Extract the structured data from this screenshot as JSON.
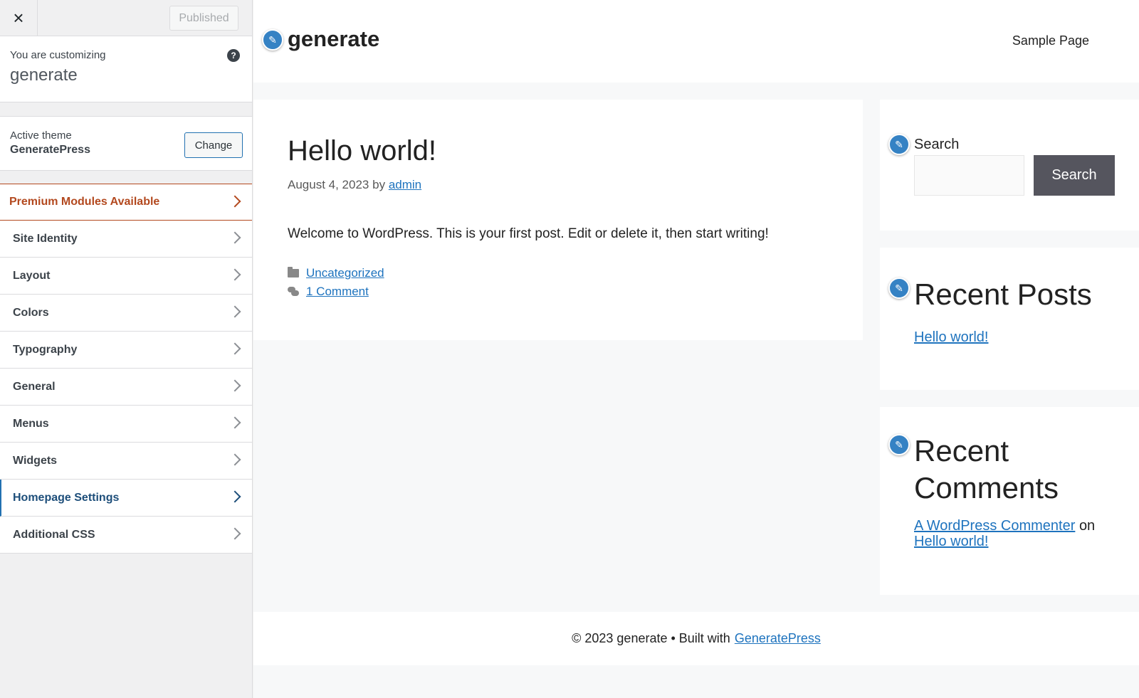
{
  "sidebar": {
    "close_icon": "×",
    "published_label": "Published",
    "customizing_label": "You are customizing",
    "site_name": "generate",
    "help_icon": "?",
    "active_theme_label": "Active theme",
    "active_theme_name": "GeneratePress",
    "change_label": "Change",
    "panels": [
      {
        "label": "Premium Modules Available"
      },
      {
        "label": "Site Identity"
      },
      {
        "label": "Layout"
      },
      {
        "label": "Colors"
      },
      {
        "label": "Typography"
      },
      {
        "label": "General"
      },
      {
        "label": "Menus"
      },
      {
        "label": "Widgets"
      },
      {
        "label": "Homepage Settings"
      },
      {
        "label": "Additional CSS"
      }
    ]
  },
  "preview": {
    "site_title": "generate",
    "nav_link": "Sample Page",
    "post": {
      "title": "Hello world!",
      "date": "August 4, 2023",
      "by": "by",
      "author": "admin",
      "body": "Welcome to WordPress. This is your first post. Edit or delete it, then start writing!",
      "category": "Uncategorized",
      "comments": "1 Comment"
    },
    "search_widget": {
      "label": "Search",
      "button": "Search"
    },
    "recent_posts": {
      "title": "Recent Posts",
      "link": "Hello world!"
    },
    "recent_comments": {
      "title_line1": "Recent",
      "title_line2": "Comments",
      "commenter": "A WordPress Commenter",
      "on": "on",
      "post_link": "Hello world!"
    },
    "footer": {
      "prefix": "© 2023 generate • Built with",
      "link": "GeneratePress"
    },
    "edit_icon": "✎"
  },
  "colors": {
    "premium": "#b3491f",
    "active_panel": "#1d4e7a",
    "link": "#1e73be",
    "edit_shortcut": "#3582c4",
    "search_button": "#55555e"
  }
}
